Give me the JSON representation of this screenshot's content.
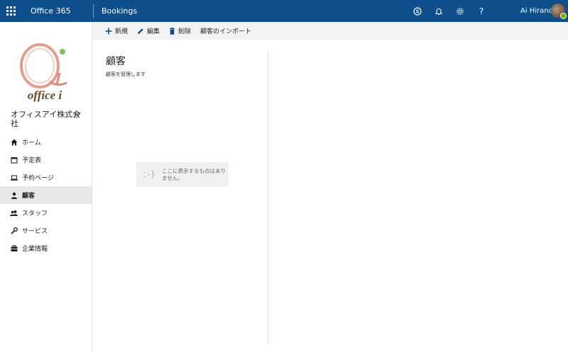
{
  "topbar": {
    "suite_name": "Office 365",
    "app_name": "Bookings",
    "icons": [
      "skype-icon",
      "bell-icon",
      "gear-icon",
      "help-icon"
    ],
    "help_glyph": "?",
    "user_name": "Ai Hirano",
    "bar_color": "#0e4e8b"
  },
  "sidebar": {
    "logo_text": "office i",
    "org_name": "オフィスアイ株式会社",
    "items": [
      {
        "label": "ホーム",
        "icon": "home-icon",
        "active": false
      },
      {
        "label": "予定表",
        "icon": "calendar-icon",
        "active": false
      },
      {
        "label": "予約ページ",
        "icon": "laptop-icon",
        "active": false
      },
      {
        "label": "顧客",
        "icon": "person-icon",
        "active": true
      },
      {
        "label": "スタッフ",
        "icon": "people-icon",
        "active": false
      },
      {
        "label": "サービス",
        "icon": "wrench-icon",
        "active": false
      },
      {
        "label": "企業情報",
        "icon": "briefcase-icon",
        "active": false
      }
    ]
  },
  "commandbar": {
    "new_label": "新規",
    "edit_label": "編集",
    "delete_label": "削除",
    "import_label": "顧客のインポート"
  },
  "main": {
    "title": "顧客",
    "subtitle": "顧客を管理します",
    "empty_face": ":-)",
    "empty_message": "ここに表示するものはありません。"
  }
}
